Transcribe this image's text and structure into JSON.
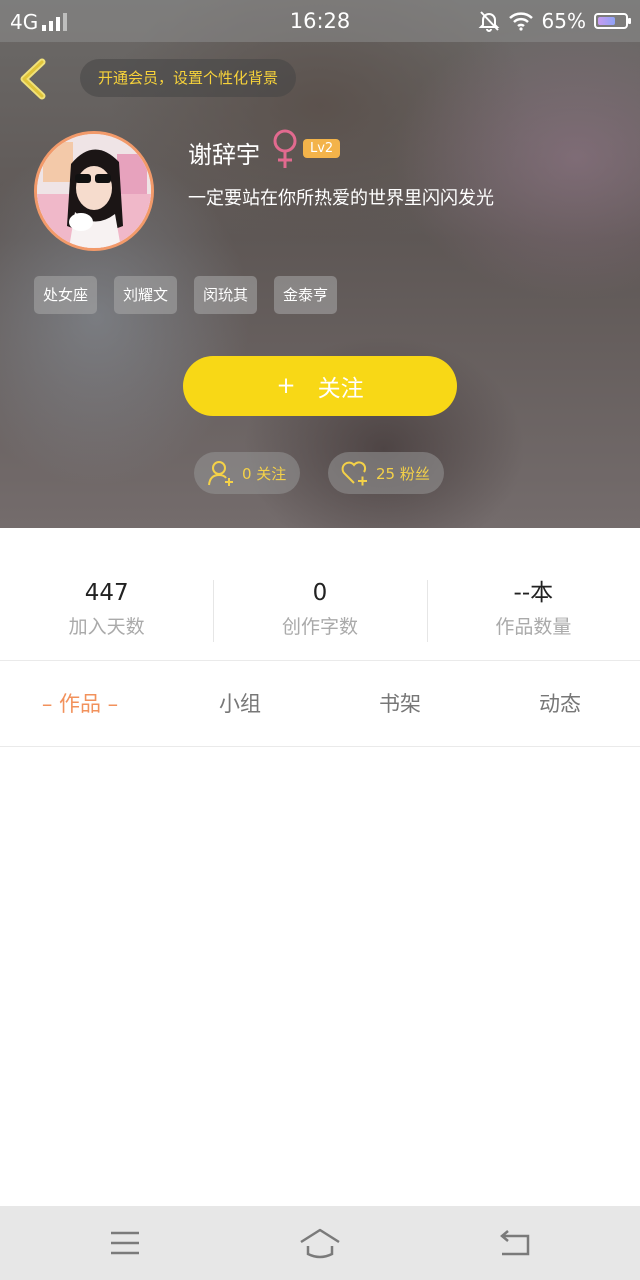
{
  "status_bar": {
    "network": "4G",
    "time": "16:28",
    "battery": "65%",
    "battery_level": 0.65
  },
  "header": {
    "vip_banner": "开通会员，设置个性化背景"
  },
  "profile": {
    "name": "谢辞宇",
    "level": "Lv2",
    "signature": "一定要站在你所热爱的世界里闪闪发光",
    "tags": [
      "处女座",
      "刘耀文",
      "闵玧其",
      "金泰亨"
    ]
  },
  "actions": {
    "follow_plus": "+",
    "follow_label": "关注",
    "following": "0 关注",
    "fans": "25 粉丝"
  },
  "stats": [
    {
      "value": "447",
      "label": "加入天数"
    },
    {
      "value": "0",
      "label": "创作字数"
    },
    {
      "value": "--本",
      "label": "作品数量"
    }
  ],
  "tabs": [
    "– 作品 –",
    "小组",
    "书架",
    "动态"
  ],
  "colors": {
    "accent_yellow": "#f8d816",
    "tab_active": "#f2915b",
    "gender_female": "#e26a8f"
  }
}
